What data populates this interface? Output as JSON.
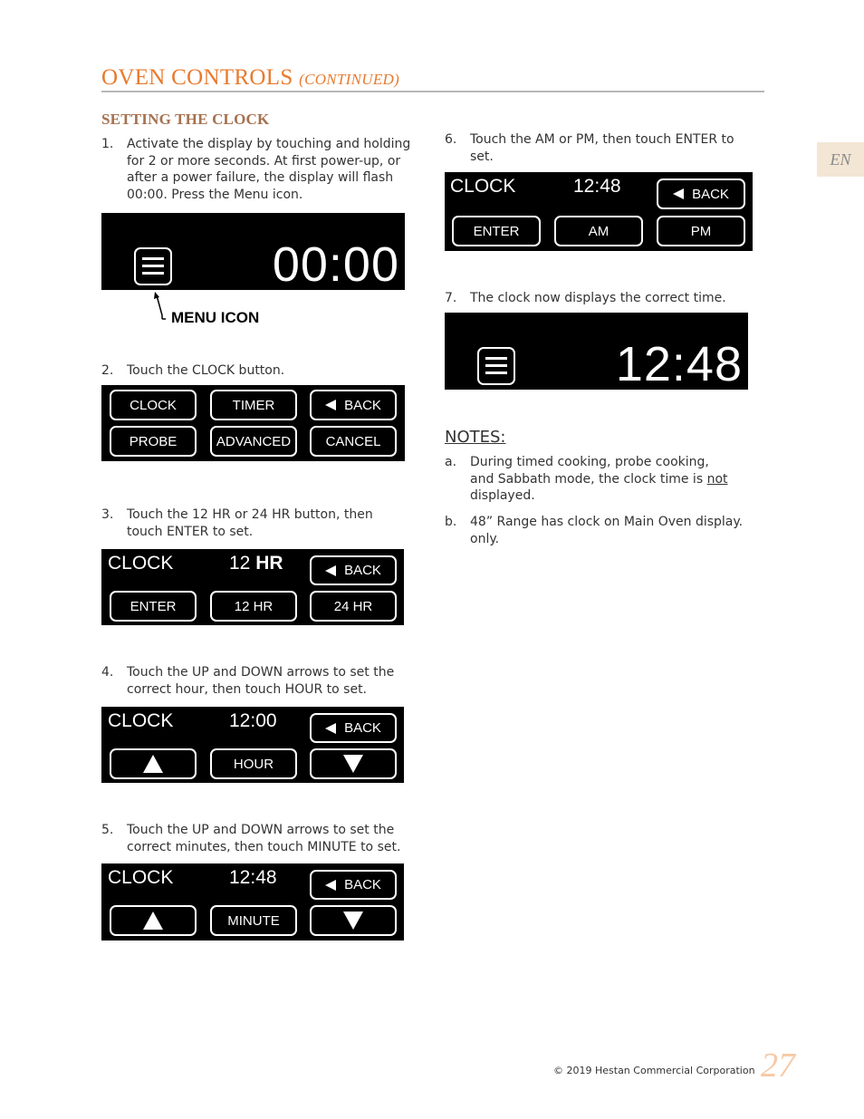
{
  "header": {
    "title": "OVEN CONTROLS",
    "title_suffix": "(CONTINUED)",
    "section": "SETTING THE CLOCK",
    "lang_tab": "EN"
  },
  "colors": {
    "title": "#e87a2e",
    "section": "#a5714f",
    "lang_tab_bg": "#f3e6d4",
    "page_number": "#f6c9a6",
    "display_bg": "#000000"
  },
  "steps": [
    {
      "num": "1.",
      "lines": [
        "Activate the display by touching and holding",
        "for 2 or more seconds.  At first power-up, or",
        "after a power failure, the display will flash",
        "00:00.  Press the Menu icon."
      ]
    },
    {
      "num": "2.",
      "lines": [
        "Touch the CLOCK button."
      ]
    },
    {
      "num": "3.",
      "lines": [
        "Touch the 12 HR or 24 HR button, then",
        "touch ENTER to set."
      ]
    },
    {
      "num": "4.",
      "lines": [
        "Touch the UP and DOWN arrows to set the",
        "correct hour, then touch HOUR to set."
      ]
    },
    {
      "num": "5.",
      "lines": [
        "Touch the UP and DOWN arrows to set the",
        "correct minutes, then touch MINUTE to set."
      ]
    },
    {
      "num": "6.",
      "lines": [
        "Touch the AM or PM, then touch ENTER to",
        "set."
      ]
    },
    {
      "num": "7.",
      "lines": [
        "The clock now displays the correct time."
      ]
    }
  ],
  "displays": {
    "d1": {
      "time": "00:00",
      "callout": "MENU ICON"
    },
    "d2": {
      "buttons": [
        "CLOCK",
        "TIMER",
        "BACK",
        "PROBE",
        "ADVANCED",
        "CANCEL"
      ]
    },
    "d3": {
      "label": "CLOCK",
      "value": "12",
      "value_bold": "HR",
      "back": "BACK",
      "buttons": [
        "ENTER",
        "12 HR",
        "24 HR"
      ]
    },
    "d4": {
      "label": "CLOCK",
      "value": "12:00",
      "back": "BACK",
      "center_button": "HOUR"
    },
    "d5": {
      "label": "CLOCK",
      "value": "12:48",
      "back": "BACK",
      "center_button": "MINUTE"
    },
    "d6": {
      "label": "CLOCK",
      "value": "12:48",
      "back": "BACK",
      "buttons": [
        "ENTER",
        "AM",
        "PM"
      ]
    },
    "d7": {
      "time": "12:48"
    }
  },
  "notes": {
    "title": "NOTES:",
    "items": [
      {
        "letter": "a.",
        "line1": "During timed cooking, probe cooking,",
        "line2_pre": "and Sabbath mode, the clock time is ",
        "line2_u": "not",
        "line3": "displayed."
      },
      {
        "letter": "b.",
        "line1": "48” Range has clock on Main Oven display.",
        "line2": "only."
      }
    ]
  },
  "footer": {
    "copyright": "© 2019 Hestan Commercial Corporation",
    "page_number": "27"
  }
}
